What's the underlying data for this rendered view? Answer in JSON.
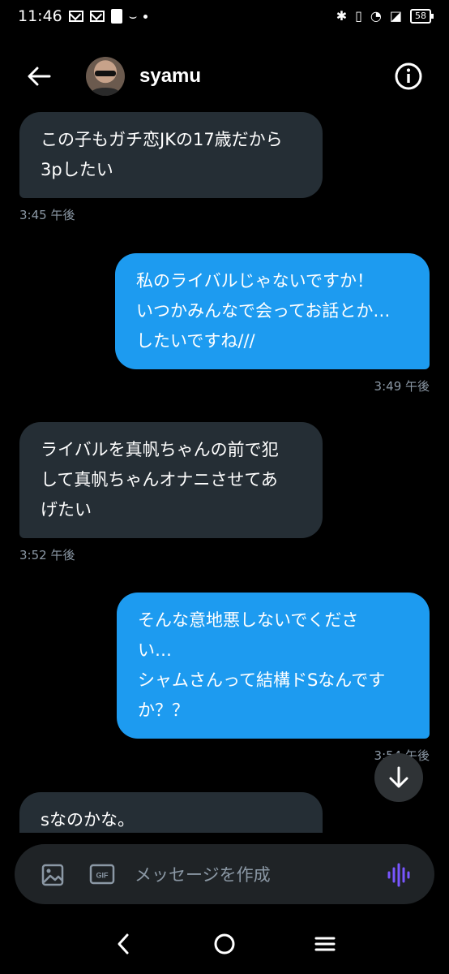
{
  "status_bar": {
    "time": "11:46",
    "battery": "58"
  },
  "header": {
    "username": "syamu"
  },
  "messages": [
    {
      "direction": "received",
      "text": "この子もガチ恋JKの17歳だから\n3pしたい",
      "time": "3:45 午後"
    },
    {
      "direction": "sent",
      "text": "私のライバルじゃないですか！\nいつかみんなで会ってお話とか…\nしたいですね///",
      "time": "3:49 午後"
    },
    {
      "direction": "received",
      "text": "ライバルを真帆ちゃんの前で犯\nして真帆ちゃんオナニさせてあ\nげたい",
      "time": "3:52 午後"
    },
    {
      "direction": "sent",
      "text": "そんな意地悪しないでくださ\nい…\nシャムさんって結構ドSなんです\nか？？",
      "time": "3:54 午後"
    },
    {
      "direction": "received",
      "text": "sなのかな。",
      "time": ""
    }
  ],
  "composer": {
    "placeholder": "メッセージを作成",
    "gif_label": "GIF"
  },
  "colors": {
    "sent_bubble": "#1d9bf0",
    "received_bubble": "#252e35",
    "voice_accent": "#7856ff"
  }
}
